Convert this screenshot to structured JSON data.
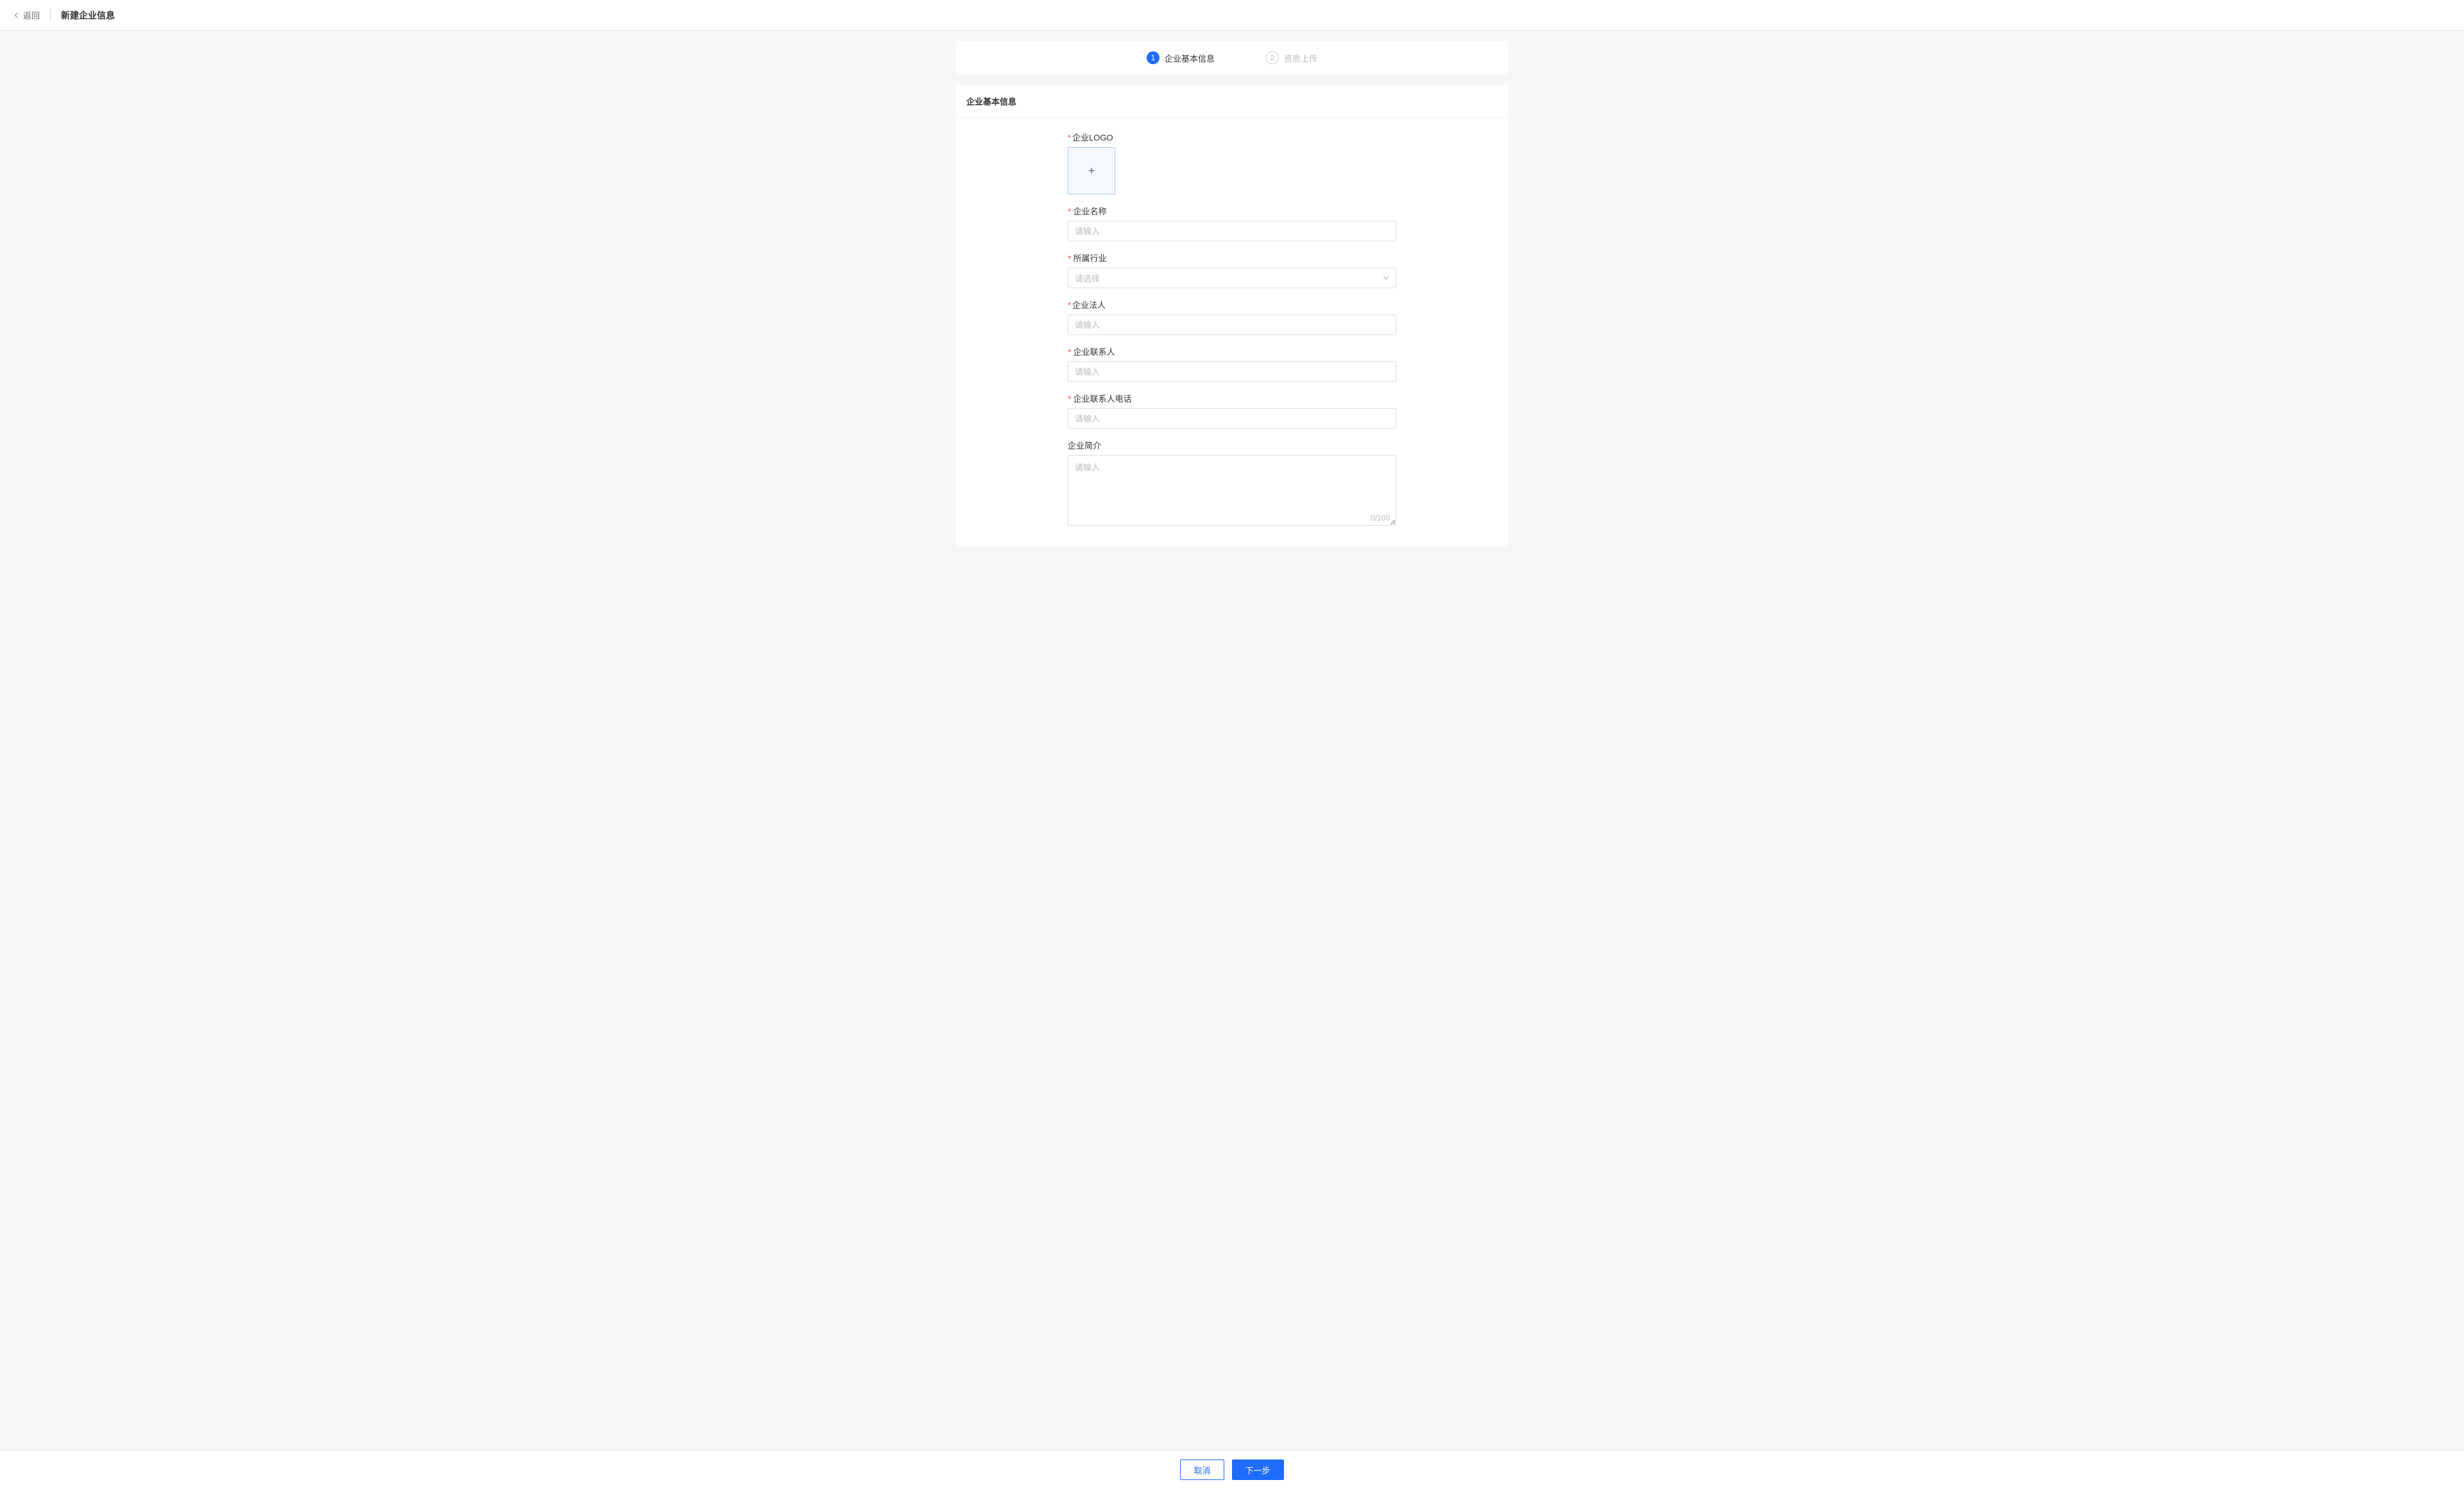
{
  "header": {
    "back_label": "返回",
    "page_title": "新建企业信息"
  },
  "steps": [
    {
      "num": "1",
      "label": "企业基本信息",
      "active": true
    },
    {
      "num": "2",
      "label": "资质上传",
      "active": false
    }
  ],
  "form": {
    "section_title": "企业基本信息",
    "logo": {
      "label": "企业LOGO"
    },
    "name": {
      "label": "企业名称",
      "placeholder": "请输入"
    },
    "industry": {
      "label": "所属行业",
      "placeholder": "请选择"
    },
    "legal": {
      "label": "企业法人",
      "placeholder": "请输入"
    },
    "contact": {
      "label": "企业联系人",
      "placeholder": "请输入"
    },
    "phone": {
      "label": "企业联系人电话",
      "placeholder": "请输入"
    },
    "intro": {
      "label": "企业简介",
      "placeholder": "请输入",
      "count": "0/100"
    }
  },
  "footer": {
    "cancel": "取消",
    "next": "下一步"
  }
}
